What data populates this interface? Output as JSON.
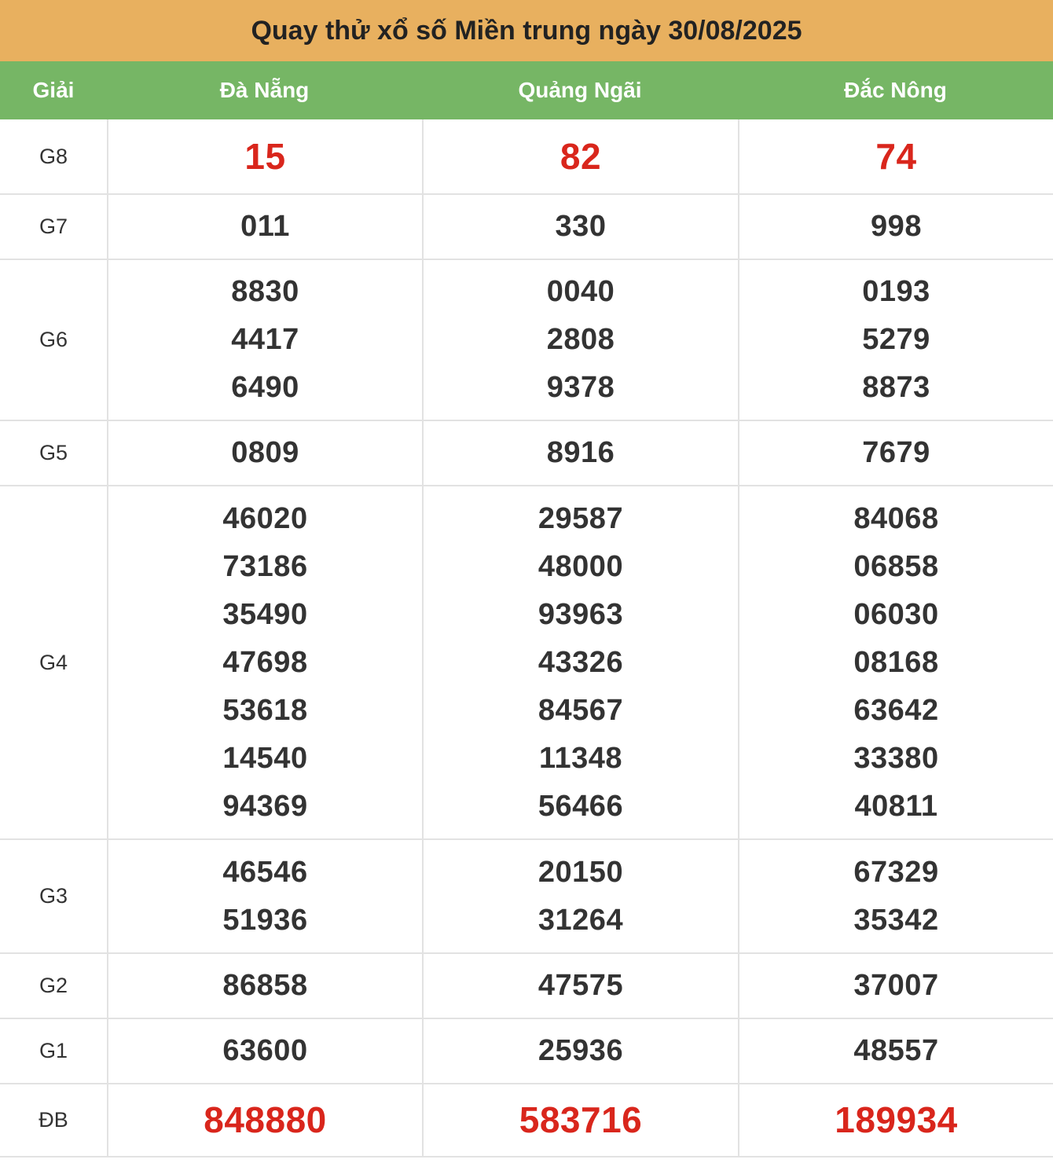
{
  "title": "Quay thử xổ số Miền trung ngày 30/08/2025",
  "headers": {
    "prize": "Giải",
    "provinces": [
      "Đà Nẵng",
      "Quảng Ngãi",
      "Đắc Nông"
    ]
  },
  "accent_colors": {
    "title_bg": "#e8b05f",
    "header_bg": "#76b665",
    "highlight": "#d9261c"
  },
  "rows": [
    {
      "prize": "G8",
      "values": [
        [
          "15"
        ],
        [
          "82"
        ],
        [
          "74"
        ]
      ]
    },
    {
      "prize": "G7",
      "values": [
        [
          "011"
        ],
        [
          "330"
        ],
        [
          "998"
        ]
      ]
    },
    {
      "prize": "G6",
      "values": [
        [
          "8830",
          "4417",
          "6490"
        ],
        [
          "0040",
          "2808",
          "9378"
        ],
        [
          "0193",
          "5279",
          "8873"
        ]
      ]
    },
    {
      "prize": "G5",
      "values": [
        [
          "0809"
        ],
        [
          "8916"
        ],
        [
          "7679"
        ]
      ]
    },
    {
      "prize": "G4",
      "values": [
        [
          "46020",
          "73186",
          "35490",
          "47698",
          "53618",
          "14540",
          "94369"
        ],
        [
          "29587",
          "48000",
          "93963",
          "43326",
          "84567",
          "11348",
          "56466"
        ],
        [
          "84068",
          "06858",
          "06030",
          "08168",
          "63642",
          "33380",
          "40811"
        ]
      ]
    },
    {
      "prize": "G3",
      "values": [
        [
          "46546",
          "51936"
        ],
        [
          "20150",
          "31264"
        ],
        [
          "67329",
          "35342"
        ]
      ]
    },
    {
      "prize": "G2",
      "values": [
        [
          "86858"
        ],
        [
          "47575"
        ],
        [
          "37007"
        ]
      ]
    },
    {
      "prize": "G1",
      "values": [
        [
          "63600"
        ],
        [
          "25936"
        ],
        [
          "48557"
        ]
      ]
    },
    {
      "prize": "ĐB",
      "values": [
        [
          "848880"
        ],
        [
          "583716"
        ],
        [
          "189934"
        ]
      ]
    }
  ]
}
